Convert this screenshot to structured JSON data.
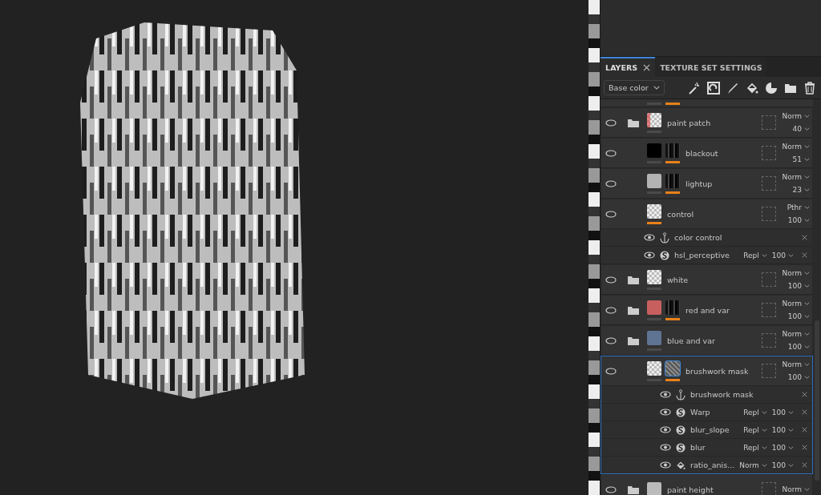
{
  "panel": {
    "tabs": [
      {
        "label": "LAYERS",
        "selected": true,
        "closable": true
      },
      {
        "label": "TEXTURE SET SETTINGS",
        "selected": false,
        "closable": false
      }
    ],
    "channel": "Base color",
    "layers": [
      {
        "name": "paint patch",
        "kind": "folder",
        "thumb": {
          "kind": "marked"
        },
        "content_active": false,
        "blend": "Norm",
        "opacity": "40",
        "selected": false
      },
      {
        "name": "blackout",
        "kind": "fill",
        "thumb": {
          "kind": "solid",
          "color": "#000000"
        },
        "mask": {
          "active": true
        },
        "content_active": false,
        "blend": "Norm",
        "opacity": "51",
        "selected": false
      },
      {
        "name": "lightup",
        "kind": "fill",
        "thumb": {
          "kind": "solid",
          "color": "#b3b3b3"
        },
        "mask": {
          "active": true
        },
        "content_active": false,
        "blend": "Norm",
        "opacity": "23",
        "selected": false
      },
      {
        "name": "control",
        "kind": "fill",
        "thumb": {
          "kind": "checker"
        },
        "content_active": true,
        "blend": "Pthr",
        "opacity": "100",
        "selected": false,
        "effects": [
          {
            "name": "color control",
            "kind": "anchor"
          },
          {
            "name": "hsl_perceptive",
            "kind": "filter",
            "blend": "Repl",
            "opacity": "100"
          }
        ]
      },
      {
        "name": "white",
        "kind": "folder",
        "thumb": {
          "kind": "checker"
        },
        "content_active": false,
        "blend": "Norm",
        "opacity": "100",
        "selected": false
      },
      {
        "name": "red and var",
        "kind": "folder",
        "thumb": {
          "kind": "solid",
          "color": "#c75f5f"
        },
        "mask": {
          "active": true
        },
        "content_active": false,
        "blend": "Norm",
        "opacity": "100",
        "selected": false
      },
      {
        "name": "blue and var",
        "kind": "folder",
        "thumb": {
          "kind": "solid",
          "color": "#5f7393"
        },
        "content_active": false,
        "blend": "Norm",
        "opacity": "100",
        "selected": false
      },
      {
        "name": "brushwork mask",
        "kind": "fill",
        "thumb": {
          "kind": "checker"
        },
        "mask": {
          "active": true
        },
        "content_active": false,
        "blend": "Norm",
        "opacity": "100",
        "selected": true,
        "mask_effects": [
          {
            "name": "brushwork mask",
            "kind": "anchor"
          },
          {
            "name": "Warp",
            "kind": "filter",
            "blend": "Repl",
            "opacity": "100"
          },
          {
            "name": "blur_slope",
            "kind": "filter",
            "blend": "Repl",
            "opacity": "100"
          },
          {
            "name": "blur",
            "kind": "filter",
            "blend": "Repl",
            "opacity": "100"
          },
          {
            "name": "ratio_anis...",
            "kind": "fill",
            "blend": "Norm",
            "opacity": "100"
          }
        ]
      },
      {
        "name": "paint height",
        "kind": "folder",
        "thumb": {
          "kind": "solid",
          "color": "#bbbbbb"
        },
        "blend": "Norm",
        "selected": false
      }
    ]
  }
}
